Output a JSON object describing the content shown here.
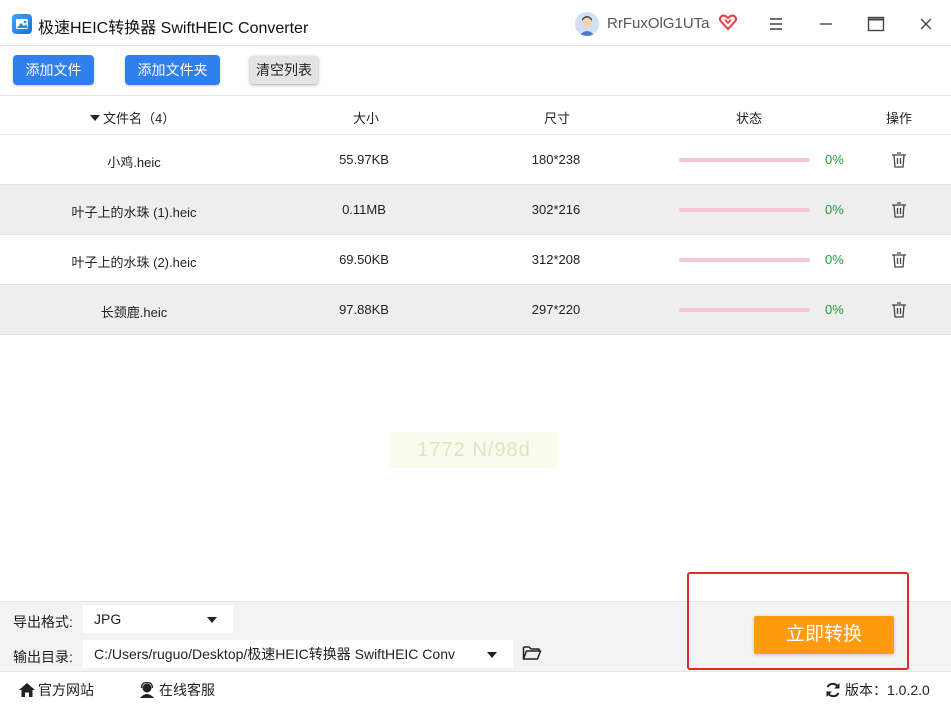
{
  "window": {
    "title": "极速HEIC转换器 SwiftHEIC Converter",
    "user_name": "RrFuxOlG1UTa"
  },
  "toolbar": {
    "add_file": "添加文件",
    "add_folder": "添加文件夹",
    "clear_list": "清空列表"
  },
  "table": {
    "headers": {
      "filename": "文件名（4）",
      "size": "大小",
      "dimensions": "尺寸",
      "status": "状态",
      "action": "操作"
    },
    "rows": [
      {
        "name": "小鸡.heic",
        "size": "55.97KB",
        "dimensions": "180*238",
        "progress": "0%"
      },
      {
        "name": "叶子上的水珠 (1).heic",
        "size": "0.11MB",
        "dimensions": "302*216",
        "progress": "0%"
      },
      {
        "name": "叶子上的水珠 (2).heic",
        "size": "69.50KB",
        "dimensions": "312*208",
        "progress": "0%"
      },
      {
        "name": "长颈鹿.heic",
        "size": "97.88KB",
        "dimensions": "297*220",
        "progress": "0%"
      }
    ]
  },
  "watermark": "1772 N/98d",
  "settings": {
    "format_label": "导出格式:",
    "format_value": "JPG",
    "output_label": "输出目录:",
    "output_value": "C:/Users/ruguo/Desktop/极速HEIC转换器 SwiftHEIC Conv"
  },
  "convert_button": "立即转换",
  "footer": {
    "website": "官方网站",
    "support": "在线客服",
    "version_label": "版本：",
    "version_value": "1.0.2.0"
  },
  "colors": {
    "primary": "#2f80ed",
    "convert": "#ff9b0f",
    "progress_track": "#f4c6d3",
    "percent_text": "#1f9d3a",
    "highlight": "#e02a2a"
  },
  "icons": [
    "app-logo-icon",
    "avatar",
    "vip-heart-icon",
    "menu-icon",
    "minimize-icon",
    "maximize-icon",
    "close-icon",
    "sort-down-icon",
    "trash-icon",
    "folder-icon",
    "home-icon",
    "support-agent-icon",
    "refresh-icon"
  ]
}
